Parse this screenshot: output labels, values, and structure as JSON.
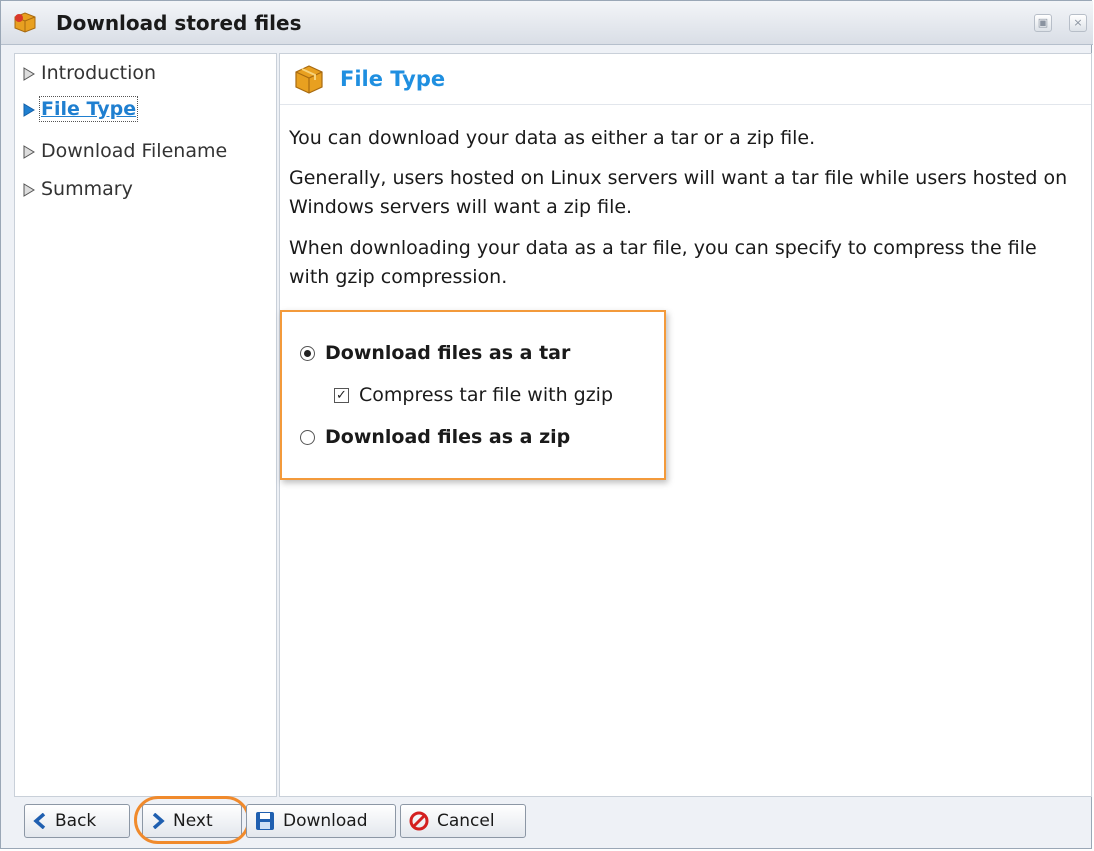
{
  "window": {
    "title": "Download stored files",
    "title_icon": "package-icon",
    "controls": [
      "restore-icon",
      "close-icon"
    ]
  },
  "sidebar": {
    "items": [
      {
        "label": "Introduction",
        "active": false
      },
      {
        "label": "File Type",
        "active": true
      },
      {
        "label": "Download Filename",
        "active": false
      },
      {
        "label": "Summary",
        "active": false
      }
    ]
  },
  "main": {
    "header": {
      "title": "File Type",
      "icon": "package-icon"
    },
    "paragraphs": [
      "You can download your data as either a tar or a zip file.",
      "Generally, users hosted on Linux servers will want a tar file while users hosted on Windows servers will want a zip file.",
      "When downloading your data as a tar file, you can specify to compress the file with gzip compression."
    ],
    "options": {
      "tar_label": "Download files as a tar",
      "tar_selected": true,
      "gzip_label": "Compress tar file with gzip",
      "gzip_checked": true,
      "zip_label": "Download files as a zip",
      "zip_selected": false
    }
  },
  "footer": {
    "back_label": "Back",
    "next_label": "Next",
    "download_label": "Download",
    "cancel_label": "Cancel"
  },
  "colors": {
    "accent": "#1f8fe0",
    "highlight": "#f39a3b",
    "cancel_red": "#d42020"
  }
}
